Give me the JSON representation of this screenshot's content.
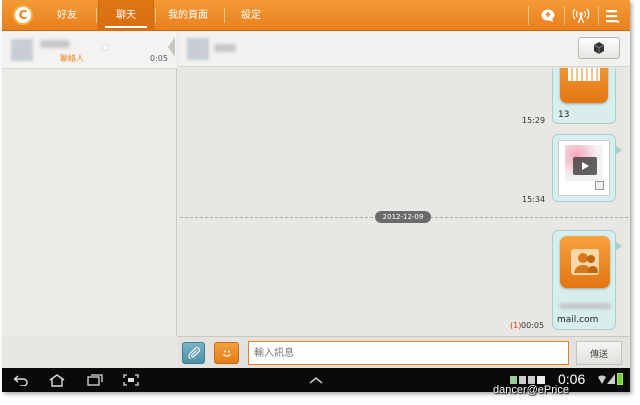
{
  "topbar": {
    "tabs": [
      {
        "label": "好友",
        "active": false
      },
      {
        "label": "聊天",
        "active": true
      },
      {
        "label": "我的頁面",
        "active": false
      },
      {
        "label": "設定",
        "active": false
      }
    ],
    "icons": [
      "add-chat-icon",
      "broadcast-icon",
      "menu-icon"
    ]
  },
  "contact_list": {
    "items": [
      {
        "subtitle": "聯絡人",
        "time": "0:05"
      }
    ]
  },
  "chat": {
    "messages": [
      {
        "type": "image",
        "caption": "13",
        "time": "15:29"
      },
      {
        "type": "video",
        "time": "15:34"
      },
      {
        "type": "contact",
        "email": "mail.com",
        "unread": "(1)",
        "time": "00:05"
      }
    ],
    "date_divider": "2012-12-09"
  },
  "input": {
    "placeholder": "輸入訊息",
    "send_label": "傳送"
  },
  "statusbar": {
    "clock": "0:06",
    "watermark": "dancer@ePrice"
  },
  "colors": {
    "brand_orange": "#e8801e",
    "bubble": "#d7eeed",
    "unread_red": "#cc3300"
  }
}
